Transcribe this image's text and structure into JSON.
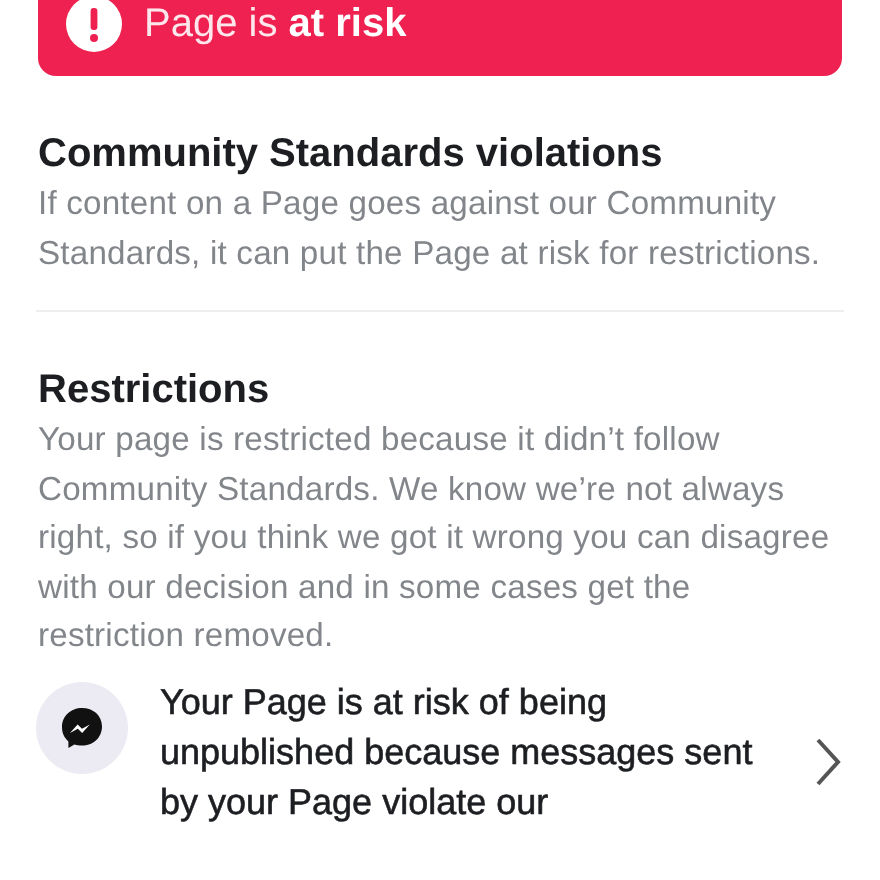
{
  "banner": {
    "text": "Page is **at risk**"
  },
  "sections": [
    {
      "heading": "Community Standards violations",
      "body": "If content on a Page goes against our Community Standards, it can put the Page at risk for restrictions."
    },
    {
      "heading": "Restrictions",
      "body": "Your page is restricted because it didn’t follow Community Standards. We know we’re not always right, so if you think we got it wrong you can disagree with our decision and in some cases get the restriction removed."
    }
  ],
  "items": [
    {
      "text": "Your Page is at risk of being unpublished because messages sent by your Page violate our"
    }
  ]
}
